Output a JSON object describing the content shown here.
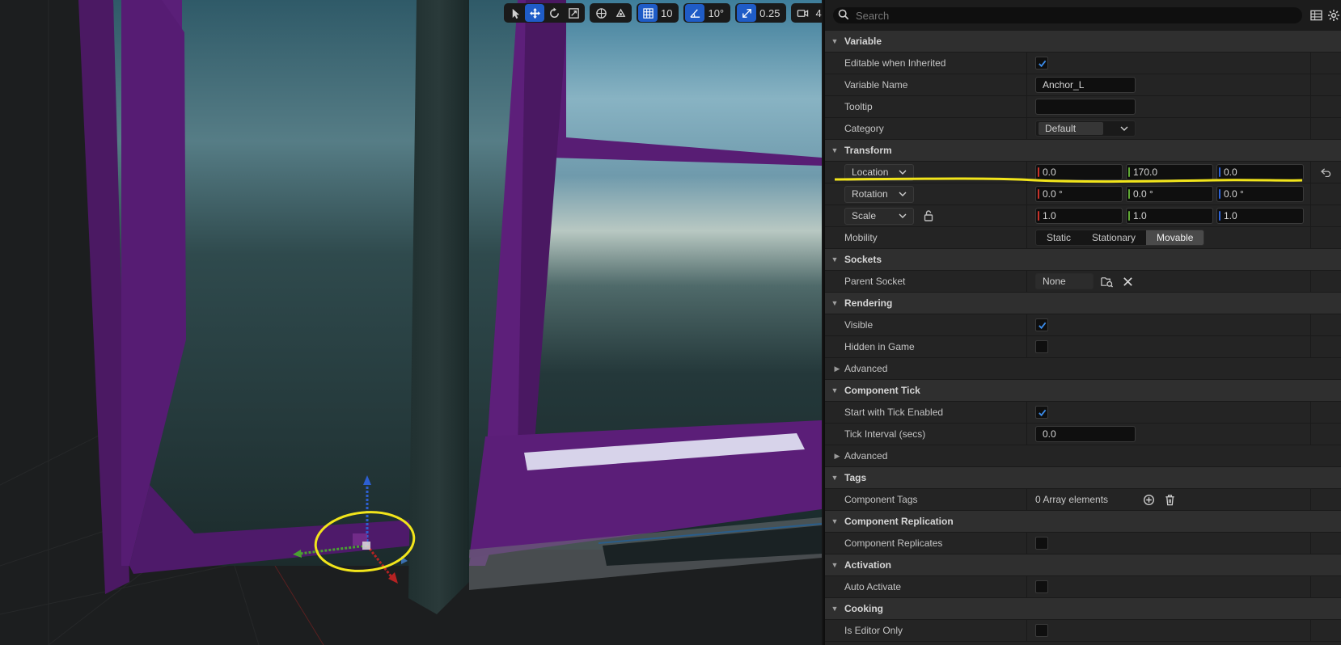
{
  "viewport": {
    "toolbar": {
      "grid_snap_value": "10",
      "rotation_snap_value": "10°",
      "scale_snap_value": "0.25",
      "camera_speed_value": "4"
    }
  },
  "details": {
    "search": {
      "placeholder": "Search"
    },
    "variable": {
      "title": "Variable",
      "editable_label": "Editable when Inherited",
      "editable_checked": true,
      "name_label": "Variable Name",
      "name_value": "Anchor_L",
      "tooltip_label": "Tooltip",
      "tooltip_value": "",
      "category_label": "Category",
      "category_value": "Default"
    },
    "transform": {
      "title": "Transform",
      "location": {
        "label": "Location",
        "x": "0.0",
        "y": "170.0",
        "z": "0.0"
      },
      "rotation": {
        "label": "Rotation",
        "x": "0.0 °",
        "y": "0.0 °",
        "z": "0.0 °"
      },
      "scale": {
        "label": "Scale",
        "x": "1.0",
        "y": "1.0",
        "z": "1.0"
      },
      "mobility_label": "Mobility",
      "mobility_options": [
        "Static",
        "Stationary",
        "Movable"
      ],
      "mobility_selected": "Movable"
    },
    "sockets": {
      "title": "Sockets",
      "parent_label": "Parent Socket",
      "parent_value": "None"
    },
    "rendering": {
      "title": "Rendering",
      "visible_label": "Visible",
      "visible_checked": true,
      "hidden_label": "Hidden in Game",
      "hidden_checked": false,
      "advanced_label": "Advanced"
    },
    "component_tick": {
      "title": "Component Tick",
      "start_label": "Start with Tick Enabled",
      "start_checked": true,
      "interval_label": "Tick Interval (secs)",
      "interval_value": "0.0",
      "advanced_label": "Advanced"
    },
    "tags": {
      "title": "Tags",
      "tags_label": "Component Tags",
      "tags_value": "0 Array elements"
    },
    "replication": {
      "title": "Component Replication",
      "replicates_label": "Component Replicates",
      "replicates_checked": false
    },
    "activation": {
      "title": "Activation",
      "auto_label": "Auto Activate",
      "auto_checked": false
    },
    "cooking": {
      "title": "Cooking",
      "editor_only_label": "Is Editor Only",
      "editor_only_checked": false
    }
  }
}
